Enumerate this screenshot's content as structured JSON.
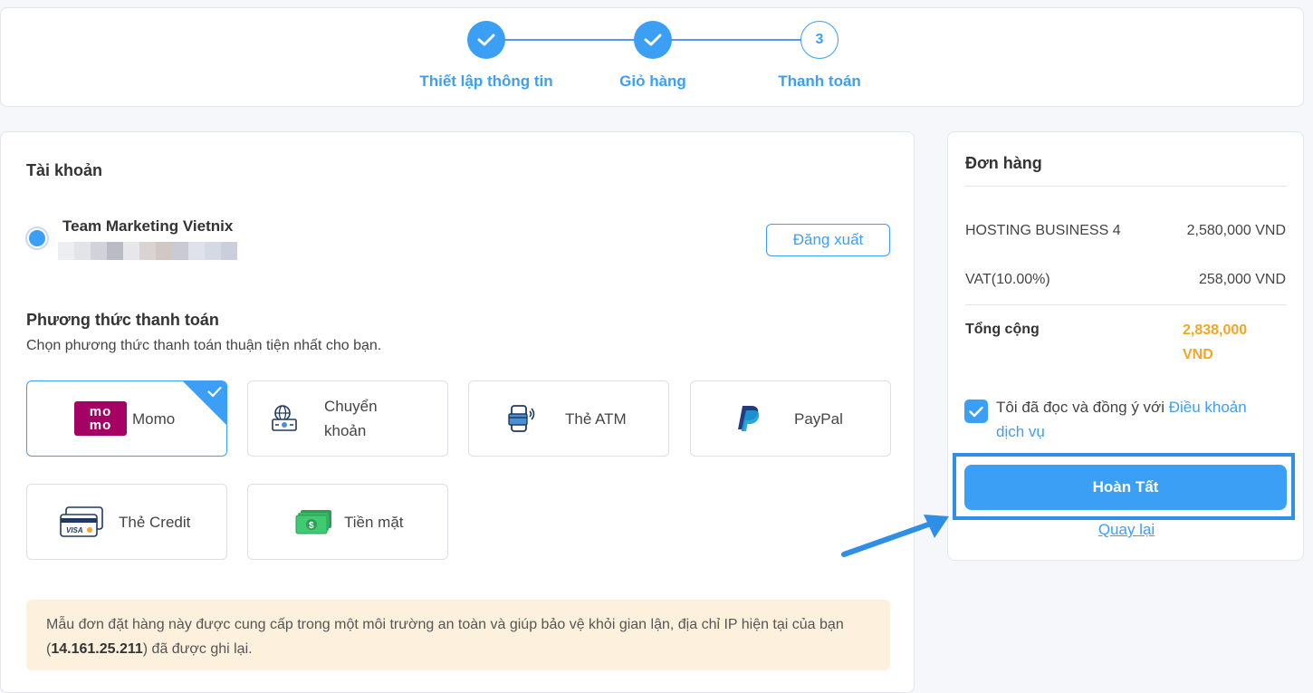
{
  "steps": [
    {
      "label": "Thiết lập thông tin",
      "state": "done"
    },
    {
      "label": "Giỏ hàng",
      "state": "done"
    },
    {
      "label": "Thanh toán",
      "state": "current",
      "number": "3"
    }
  ],
  "account": {
    "title": "Tài khoản",
    "name": "Team Marketing Vietnix",
    "logout_label": "Đăng xuất"
  },
  "payment": {
    "title": "Phương thức thanh toán",
    "subtitle": "Chọn phương thức thanh toán thuận tiện nhất cho bạn.",
    "methods": [
      {
        "label": "Momo",
        "icon": "momo-logo",
        "selected": true
      },
      {
        "label": "Chuyển khoản",
        "icon": "bank-transfer-icon",
        "selected": false
      },
      {
        "label": "Thẻ ATM",
        "icon": "atm-card-icon",
        "selected": false
      },
      {
        "label": "PayPal",
        "icon": "paypal-icon",
        "selected": false
      },
      {
        "label": "Thẻ Credit",
        "icon": "credit-card-icon",
        "selected": false
      },
      {
        "label": "Tiền mặt",
        "icon": "cash-icon",
        "selected": false
      }
    ],
    "momo_logo_text": [
      "mo",
      "mo"
    ]
  },
  "notice": {
    "text_before": "Mẫu đơn đặt hàng này được cung cấp trong một môi trường an toàn và giúp bảo vệ khỏi gian lận, địa chỉ IP hiện tại của bạn (",
    "ip": "14.161.25.211",
    "text_after": ") đã được ghi lại."
  },
  "order": {
    "title": "Đơn hàng",
    "items": [
      {
        "name": "HOSTING BUSINESS 4",
        "price": "2,580,000 VND"
      },
      {
        "name": "VAT(10.00%)",
        "price": "258,000 VND"
      }
    ],
    "total_label": "Tổng cộng",
    "total_value": "2,838,000 VND",
    "agree_text": "Tôi đã đọc và đồng ý với ",
    "terms_link": "Điều khoản dịch vụ",
    "agreed": true,
    "submit_label": "Hoàn Tất",
    "back_label": "Quay lại"
  },
  "colors": {
    "accent": "#3b9ff5",
    "total": "#f5a623",
    "momo": "#a50064",
    "notice_bg": "#fdf1dd"
  }
}
